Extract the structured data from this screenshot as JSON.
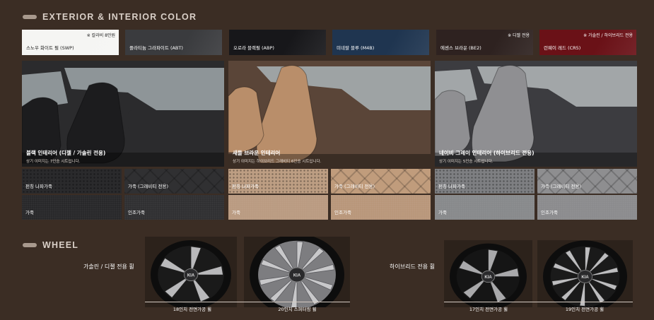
{
  "sections": {
    "color_title": "EXTERIOR & INTERIOR COLOR",
    "wheel_title": "WHEEL"
  },
  "exterior": [
    {
      "name": "스노우 화이트 펄 (SWP)",
      "note": "※ 칼라비 8만원",
      "color": "#f5f5f3"
    },
    {
      "name": "플라티늄 그라파이트 (ABT)",
      "note": "",
      "color": "#3a3b3e"
    },
    {
      "name": "오로라 블랙펄 (ABP)",
      "note": "",
      "color": "#17171a"
    },
    {
      "name": "미네랄 블루 (M4B)",
      "note": "",
      "color": "#1f3550"
    },
    {
      "name": "에센스 브라운 (BE2)",
      "note": "※ 디젤 전용",
      "color": "#2e2220"
    },
    {
      "name": "런웨이 레드 (CR5)",
      "note": "※ 가솔린 / 하이브리드 전용",
      "color": "#6a1117"
    }
  ],
  "interiors": [
    {
      "title": "블랙 인테리어 (디젤 / 가솔린 전용)",
      "subtitle": "상기 이미지는 7인승 시트입니다.",
      "seat": "#1c1c1e",
      "cabin": "#2b2b2d",
      "window": "#8e9598",
      "textures": [
        {
          "label": "펀칭 나파가죽",
          "color": "#2a2a2c"
        },
        {
          "label": "가죽 (그래비티 전용)",
          "color": "#303032"
        },
        {
          "label": "가죽",
          "color": "#262628"
        },
        {
          "label": "인조가죽",
          "color": "#2e2e30"
        }
      ]
    },
    {
      "title": "새들 브라운 인테리어",
      "subtitle": "상기 이미지는 하이브리드 그래비티 6인승 시트입니다.",
      "seat": "#b98e6a",
      "cabin": "#5a4538",
      "window": "#9ea3a4",
      "textures": [
        {
          "label": "펀칭 나파가죽",
          "color": "#bd9e83"
        },
        {
          "label": "가죽 (그래비티 전용)",
          "color": "#c09c7c"
        },
        {
          "label": "가죽",
          "color": "#b99a80"
        },
        {
          "label": "인조가죽",
          "color": "#b89679"
        }
      ]
    },
    {
      "title": "네이비 그레이 인테리어 (하이브리드 전용)",
      "subtitle": "상기 이미지는 5인승 시트입니다.",
      "seat": "#8f8f92",
      "cabin": "#3c3c40",
      "window": "#a2a6a8",
      "textures": [
        {
          "label": "펀칭 나파가죽",
          "color": "#7e7f82"
        },
        {
          "label": "가죽 (그래비티 전용)",
          "color": "#8e8e90"
        },
        {
          "label": "가죽",
          "color": "#87888a"
        },
        {
          "label": "인조가죽",
          "color": "#8a8a8d"
        }
      ]
    }
  ],
  "wheels": {
    "gas_label": "가솔린 / 디젤 전용 휠",
    "hybrid_label": "하이브리드 전용 휠",
    "items": [
      {
        "caption": "18인치 전면가공 휠"
      },
      {
        "caption": "20인치 스퍼터링 휠"
      },
      {
        "caption": "17인치 전면가공 휠"
      },
      {
        "caption": "19인치 전면가공 휠"
      }
    ]
  }
}
